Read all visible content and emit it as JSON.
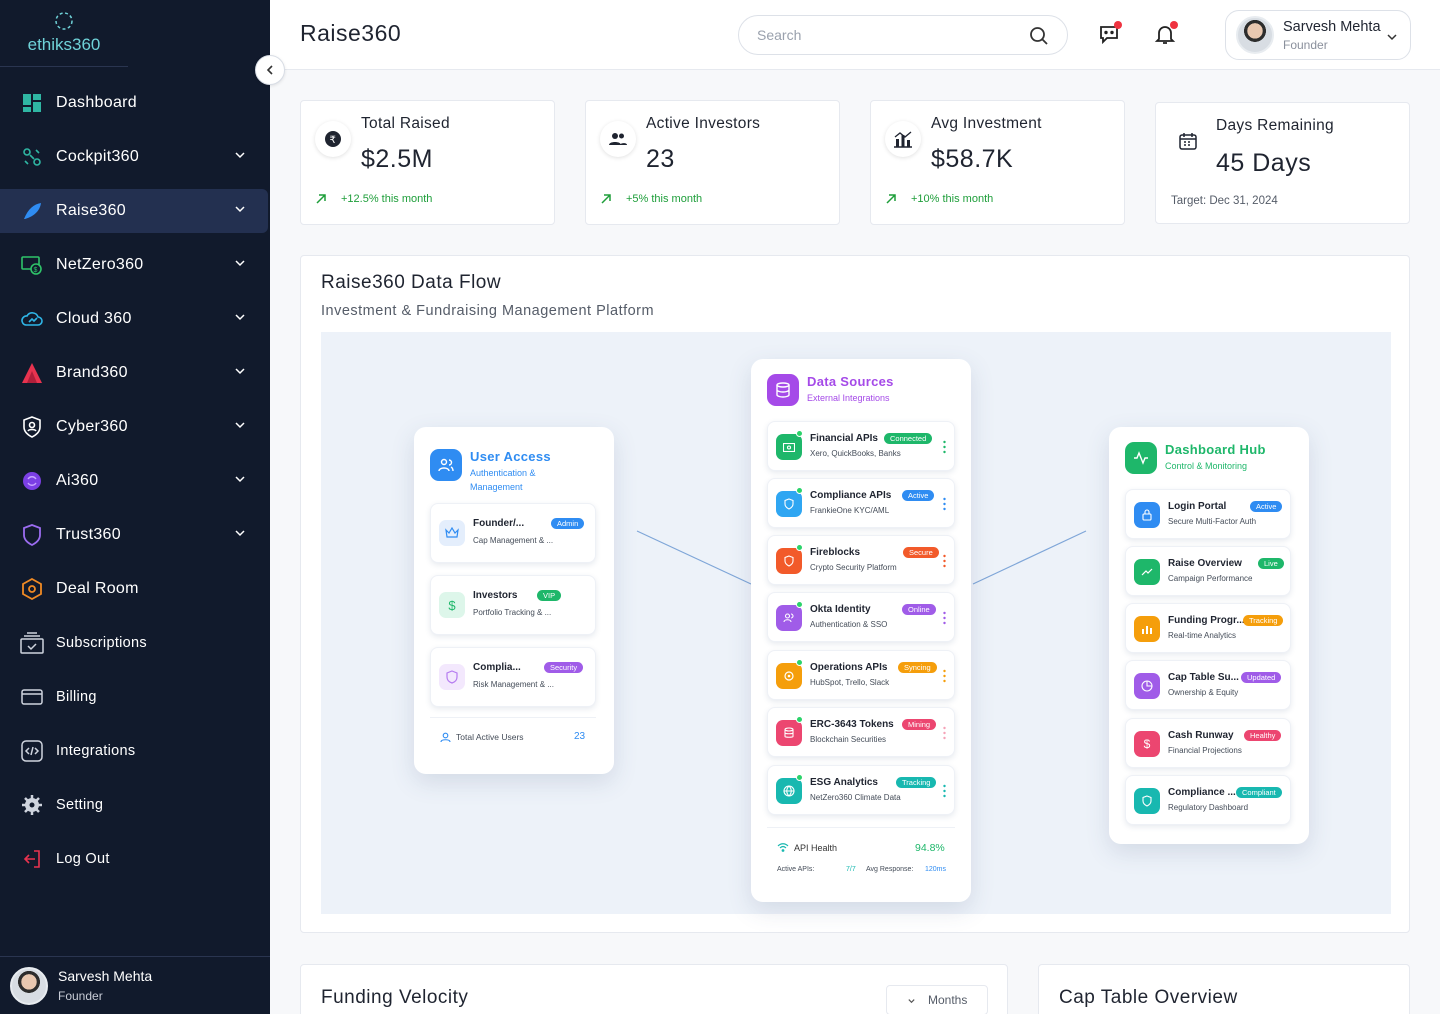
{
  "brand": {
    "logo_text": "ethiks360"
  },
  "sidebar": {
    "items": [
      {
        "label": "Dashboard"
      },
      {
        "label": "Cockpit360"
      },
      {
        "label": "Raise360"
      },
      {
        "label": "NetZero360"
      },
      {
        "label": "Cloud 360"
      },
      {
        "label": "Brand360"
      },
      {
        "label": "Cyber360"
      },
      {
        "label": "Ai360"
      },
      {
        "label": "Trust360"
      },
      {
        "label": "Deal Room"
      },
      {
        "label": "Subscriptions"
      },
      {
        "label": "Billing"
      },
      {
        "label": "Integrations"
      },
      {
        "label": "Setting"
      },
      {
        "label": "Log Out"
      }
    ],
    "user": {
      "name": "Sarvesh Mehta",
      "role": "Founder"
    }
  },
  "header": {
    "title": "Raise360",
    "search_placeholder": "Search",
    "user": {
      "name": "Sarvesh Mehta",
      "role": "Founder"
    }
  },
  "stats": [
    {
      "label": "Total Raised",
      "value": "$2.5M",
      "change": "+12.5% this month"
    },
    {
      "label": "Active Investors",
      "value": "23",
      "change": "+5% this month"
    },
    {
      "label": "Avg Investment",
      "value": "$58.7K",
      "change": "+10% this month"
    },
    {
      "label": "Days Remaining",
      "value": "45 Days",
      "target": "Target: Dec 31, 2024"
    }
  ],
  "flow": {
    "title": "Raise360 Data Flow",
    "subtitle": "Investment & Fundraising Management Platform",
    "user_access": {
      "title": "User Access",
      "subtitle_l1": "Authentication &",
      "subtitle_l2": "Management",
      "items": [
        {
          "title": "Founder/...",
          "badge": "Admin",
          "sub": "Cap Management & ..."
        },
        {
          "title": "Investors",
          "badge": "VIP",
          "sub": "Portfolio Tracking & ..."
        },
        {
          "title": "Complia...",
          "badge": "Security",
          "sub": "Risk Management & ..."
        }
      ],
      "footer_label": "Total Active Users",
      "footer_value": "23"
    },
    "data_sources": {
      "title": "Data Sources",
      "subtitle": "External Integrations",
      "items": [
        {
          "title": "Financial APIs",
          "badge": "Connected",
          "sub": "Xero, QuickBooks, Banks"
        },
        {
          "title": "Compliance APIs",
          "badge": "Active",
          "sub": "FrankieOne KYC/AML"
        },
        {
          "title": "Fireblocks",
          "badge": "Secure",
          "sub": "Crypto Security Platform"
        },
        {
          "title": "Okta Identity",
          "badge": "Online",
          "sub": "Authentication & SSO"
        },
        {
          "title": "Operations APIs",
          "badge": "Syncing",
          "sub": "HubSpot, Trello, Slack"
        },
        {
          "title": "ERC-3643 Tokens",
          "badge": "Mining",
          "sub": "Blockchain Securities"
        },
        {
          "title": "ESG Analytics",
          "badge": "Tracking",
          "sub": "NetZero360 Climate Data"
        }
      ],
      "health_label": "API Health",
      "health_value": "94.8%",
      "active_label": "Active APIs:",
      "active_value": "7/7",
      "resp_label": "Avg Response:",
      "resp_value": "120ms"
    },
    "dashboard_hub": {
      "title": "Dashboard Hub",
      "subtitle": "Control & Monitoring",
      "items": [
        {
          "title": "Login Portal",
          "badge": "Active",
          "sub": "Secure Multi-Factor Auth"
        },
        {
          "title": "Raise Overview",
          "badge": "Live",
          "sub": "Campaign Performance"
        },
        {
          "title": "Funding Progr...",
          "badge": "Tracking",
          "sub": "Real-time Analytics"
        },
        {
          "title": "Cap Table Su...",
          "badge": "Updated",
          "sub": "Ownership & Equity"
        },
        {
          "title": "Cash Runway",
          "badge": "Healthy",
          "sub": "Financial Projections"
        },
        {
          "title": "Compliance ...",
          "badge": "Compliant",
          "sub": "Regulatory Dashboard"
        }
      ]
    }
  },
  "funding_velocity": {
    "title": "Funding Velocity",
    "select_value": "Months"
  },
  "cap_table": {
    "title": "Cap Table Overview"
  }
}
